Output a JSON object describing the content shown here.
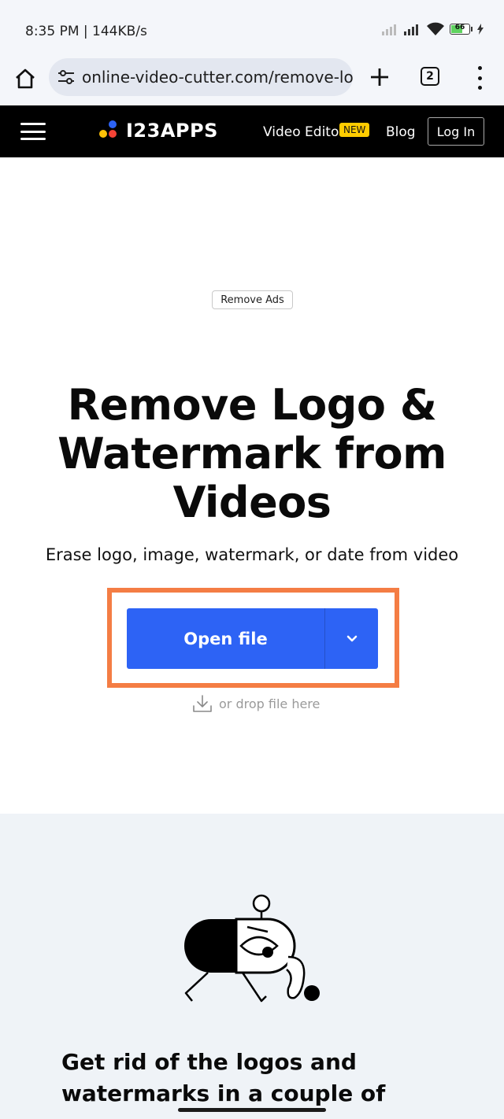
{
  "status_bar": {
    "time": "8:35 PM | 144KB/s",
    "battery": "66"
  },
  "browser": {
    "url": "online-video-cutter.com/remove-logo",
    "tab_count": "2"
  },
  "site_nav": {
    "logo_text": "I23APPS",
    "video_editor_label": "Video Editor",
    "new_badge": "NEW",
    "blog_label": "Blog",
    "login_label": "Log In"
  },
  "hero": {
    "remove_ads_label": "Remove Ads",
    "title": "Remove Logo & Watermark from Videos",
    "subtitle": "Erase logo, image, watermark, or date from video",
    "open_file_label": "Open file",
    "drop_hint": "or drop file here"
  },
  "section": {
    "heading": "Get rid of the logos and watermarks in a couple of"
  },
  "colors": {
    "primary_button": "#2d63f5",
    "highlight_frame": "#f47d44",
    "new_badge": "#ffcc00",
    "logo_dot_yellow": "#ffc107",
    "logo_dot_red": "#f44336",
    "logo_dot_blue": "#2d63f5"
  }
}
